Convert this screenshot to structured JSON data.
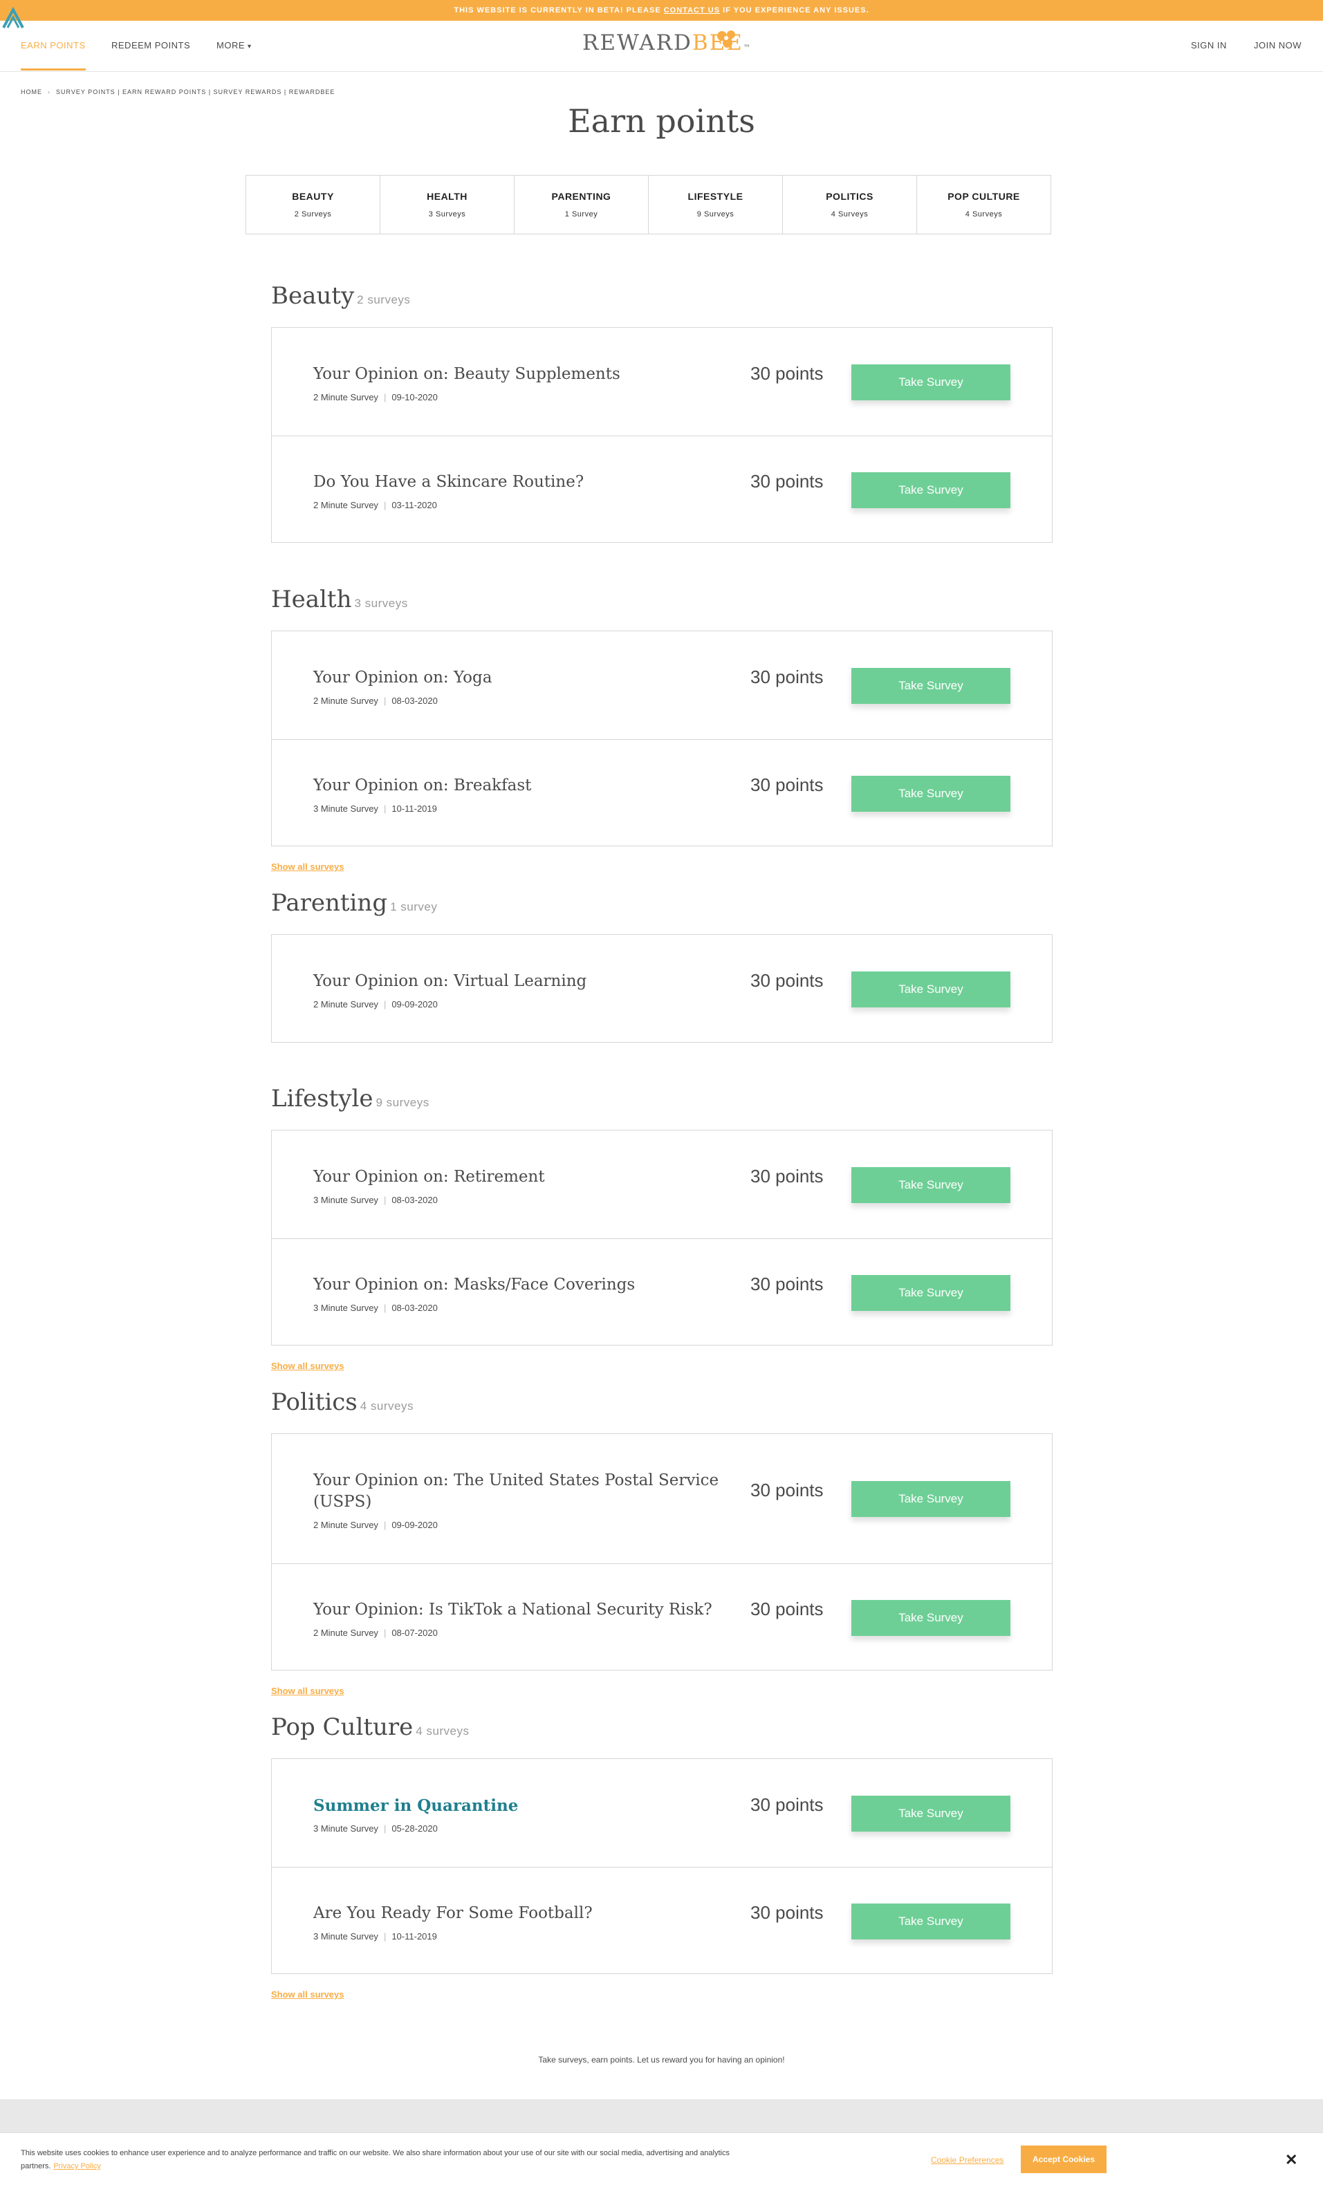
{
  "beta_banner": {
    "prefix": "THIS WEBSITE IS CURRENTLY IN BETA! PLEASE ",
    "link": "CONTACT US",
    "suffix": " IF YOU EXPERIENCE ANY ISSUES."
  },
  "nav": {
    "earn_points": "EARN POINTS",
    "redeem_points": "REDEEM POINTS",
    "more": "MORE",
    "sign_in": "SIGN IN",
    "join_now": "JOIN NOW",
    "brand_reward": "REWARD",
    "brand_bee": "BEE",
    "brand_tm": "™"
  },
  "breadcrumb": {
    "home": "HOME",
    "current": "SURVEY POINTS | EARN REWARD POINTS | SURVEY REWARDS | REWARDBEE"
  },
  "page_title": "Earn points",
  "categories": [
    {
      "name": "BEAUTY",
      "count": "2 Surveys"
    },
    {
      "name": "HEALTH",
      "count": "3 Surveys"
    },
    {
      "name": "PARENTING",
      "count": "1 Survey"
    },
    {
      "name": "LIFESTYLE",
      "count": "9 Surveys"
    },
    {
      "name": "POLITICS",
      "count": "4 Surveys"
    },
    {
      "name": "POP CULTURE",
      "count": "4 Surveys"
    }
  ],
  "sections": [
    {
      "title": "Beauty",
      "count": "2 surveys",
      "surveys": [
        {
          "title": "Your Opinion on: Beauty Supplements",
          "duration": "2 Minute Survey",
          "date": "09-10-2020",
          "points": "30 points",
          "button": "Take Survey"
        },
        {
          "title": "Do You Have a Skincare Routine?",
          "duration": "2 Minute Survey",
          "date": "03-11-2020",
          "points": "30 points",
          "button": "Take Survey"
        }
      ]
    },
    {
      "title": "Health",
      "count": "3 surveys",
      "show_all": "Show all surveys",
      "surveys": [
        {
          "title": "Your Opinion on: Yoga",
          "duration": "2 Minute Survey",
          "date": "08-03-2020",
          "points": "30 points",
          "button": "Take Survey"
        },
        {
          "title": "Your Opinion on: Breakfast",
          "duration": "3 Minute Survey",
          "date": "10-11-2019",
          "points": "30 points",
          "button": "Take Survey"
        }
      ]
    },
    {
      "title": "Parenting",
      "count": "1 survey",
      "surveys": [
        {
          "title": "Your Opinion on: Virtual Learning",
          "duration": "2 Minute Survey",
          "date": "09-09-2020",
          "points": "30 points",
          "button": "Take Survey"
        }
      ]
    },
    {
      "title": "Lifestyle",
      "count": "9 surveys",
      "show_all": "Show all surveys",
      "surveys": [
        {
          "title": "Your Opinion on: Retirement",
          "duration": "3 Minute Survey",
          "date": "08-03-2020",
          "points": "30 points",
          "button": "Take Survey"
        },
        {
          "title": "Your Opinion on: Masks/Face Coverings",
          "duration": "3 Minute Survey",
          "date": "08-03-2020",
          "points": "30 points",
          "button": "Take Survey"
        }
      ]
    },
    {
      "title": "Politics",
      "count": "4 surveys",
      "show_all": "Show all surveys",
      "surveys": [
        {
          "title": "Your Opinion on: The United States Postal Service (USPS)",
          "duration": "2 Minute Survey",
          "date": "09-09-2020",
          "points": "30 points",
          "button": "Take Survey"
        },
        {
          "title": "Your Opinion: Is TikTok a National Security Risk?",
          "duration": "2 Minute Survey",
          "date": "08-07-2020",
          "points": "30 points",
          "button": "Take Survey"
        }
      ]
    },
    {
      "title": "Pop Culture",
      "count": "4 surveys",
      "show_all": "Show all surveys",
      "surveys": [
        {
          "title": "Summer in Quarantine",
          "duration": "3 Minute Survey",
          "date": "05-28-2020",
          "points": "30 points",
          "button": "Take Survey"
        },
        {
          "title": "Are You Ready For Some Football?",
          "duration": "3 Minute Survey",
          "date": "10-11-2019",
          "points": "30 points",
          "button": "Take Survey"
        }
      ]
    }
  ],
  "tagline": "Take surveys, earn points. Let us reward you for having an opinion!",
  "cookie": {
    "text": "This website uses cookies to enhance user experience and to analyze performance and traffic on our website. We also share information about your use of our site with our social media, advertising and analytics partners.",
    "privacy": "Privacy Policy",
    "preferences": "Cookie Preferences",
    "accept": "Accept Cookies",
    "close": "✕"
  },
  "colors": {
    "accent": "#f8ad44",
    "button": "#6ecf96",
    "link_title": "#1f7f8e"
  }
}
